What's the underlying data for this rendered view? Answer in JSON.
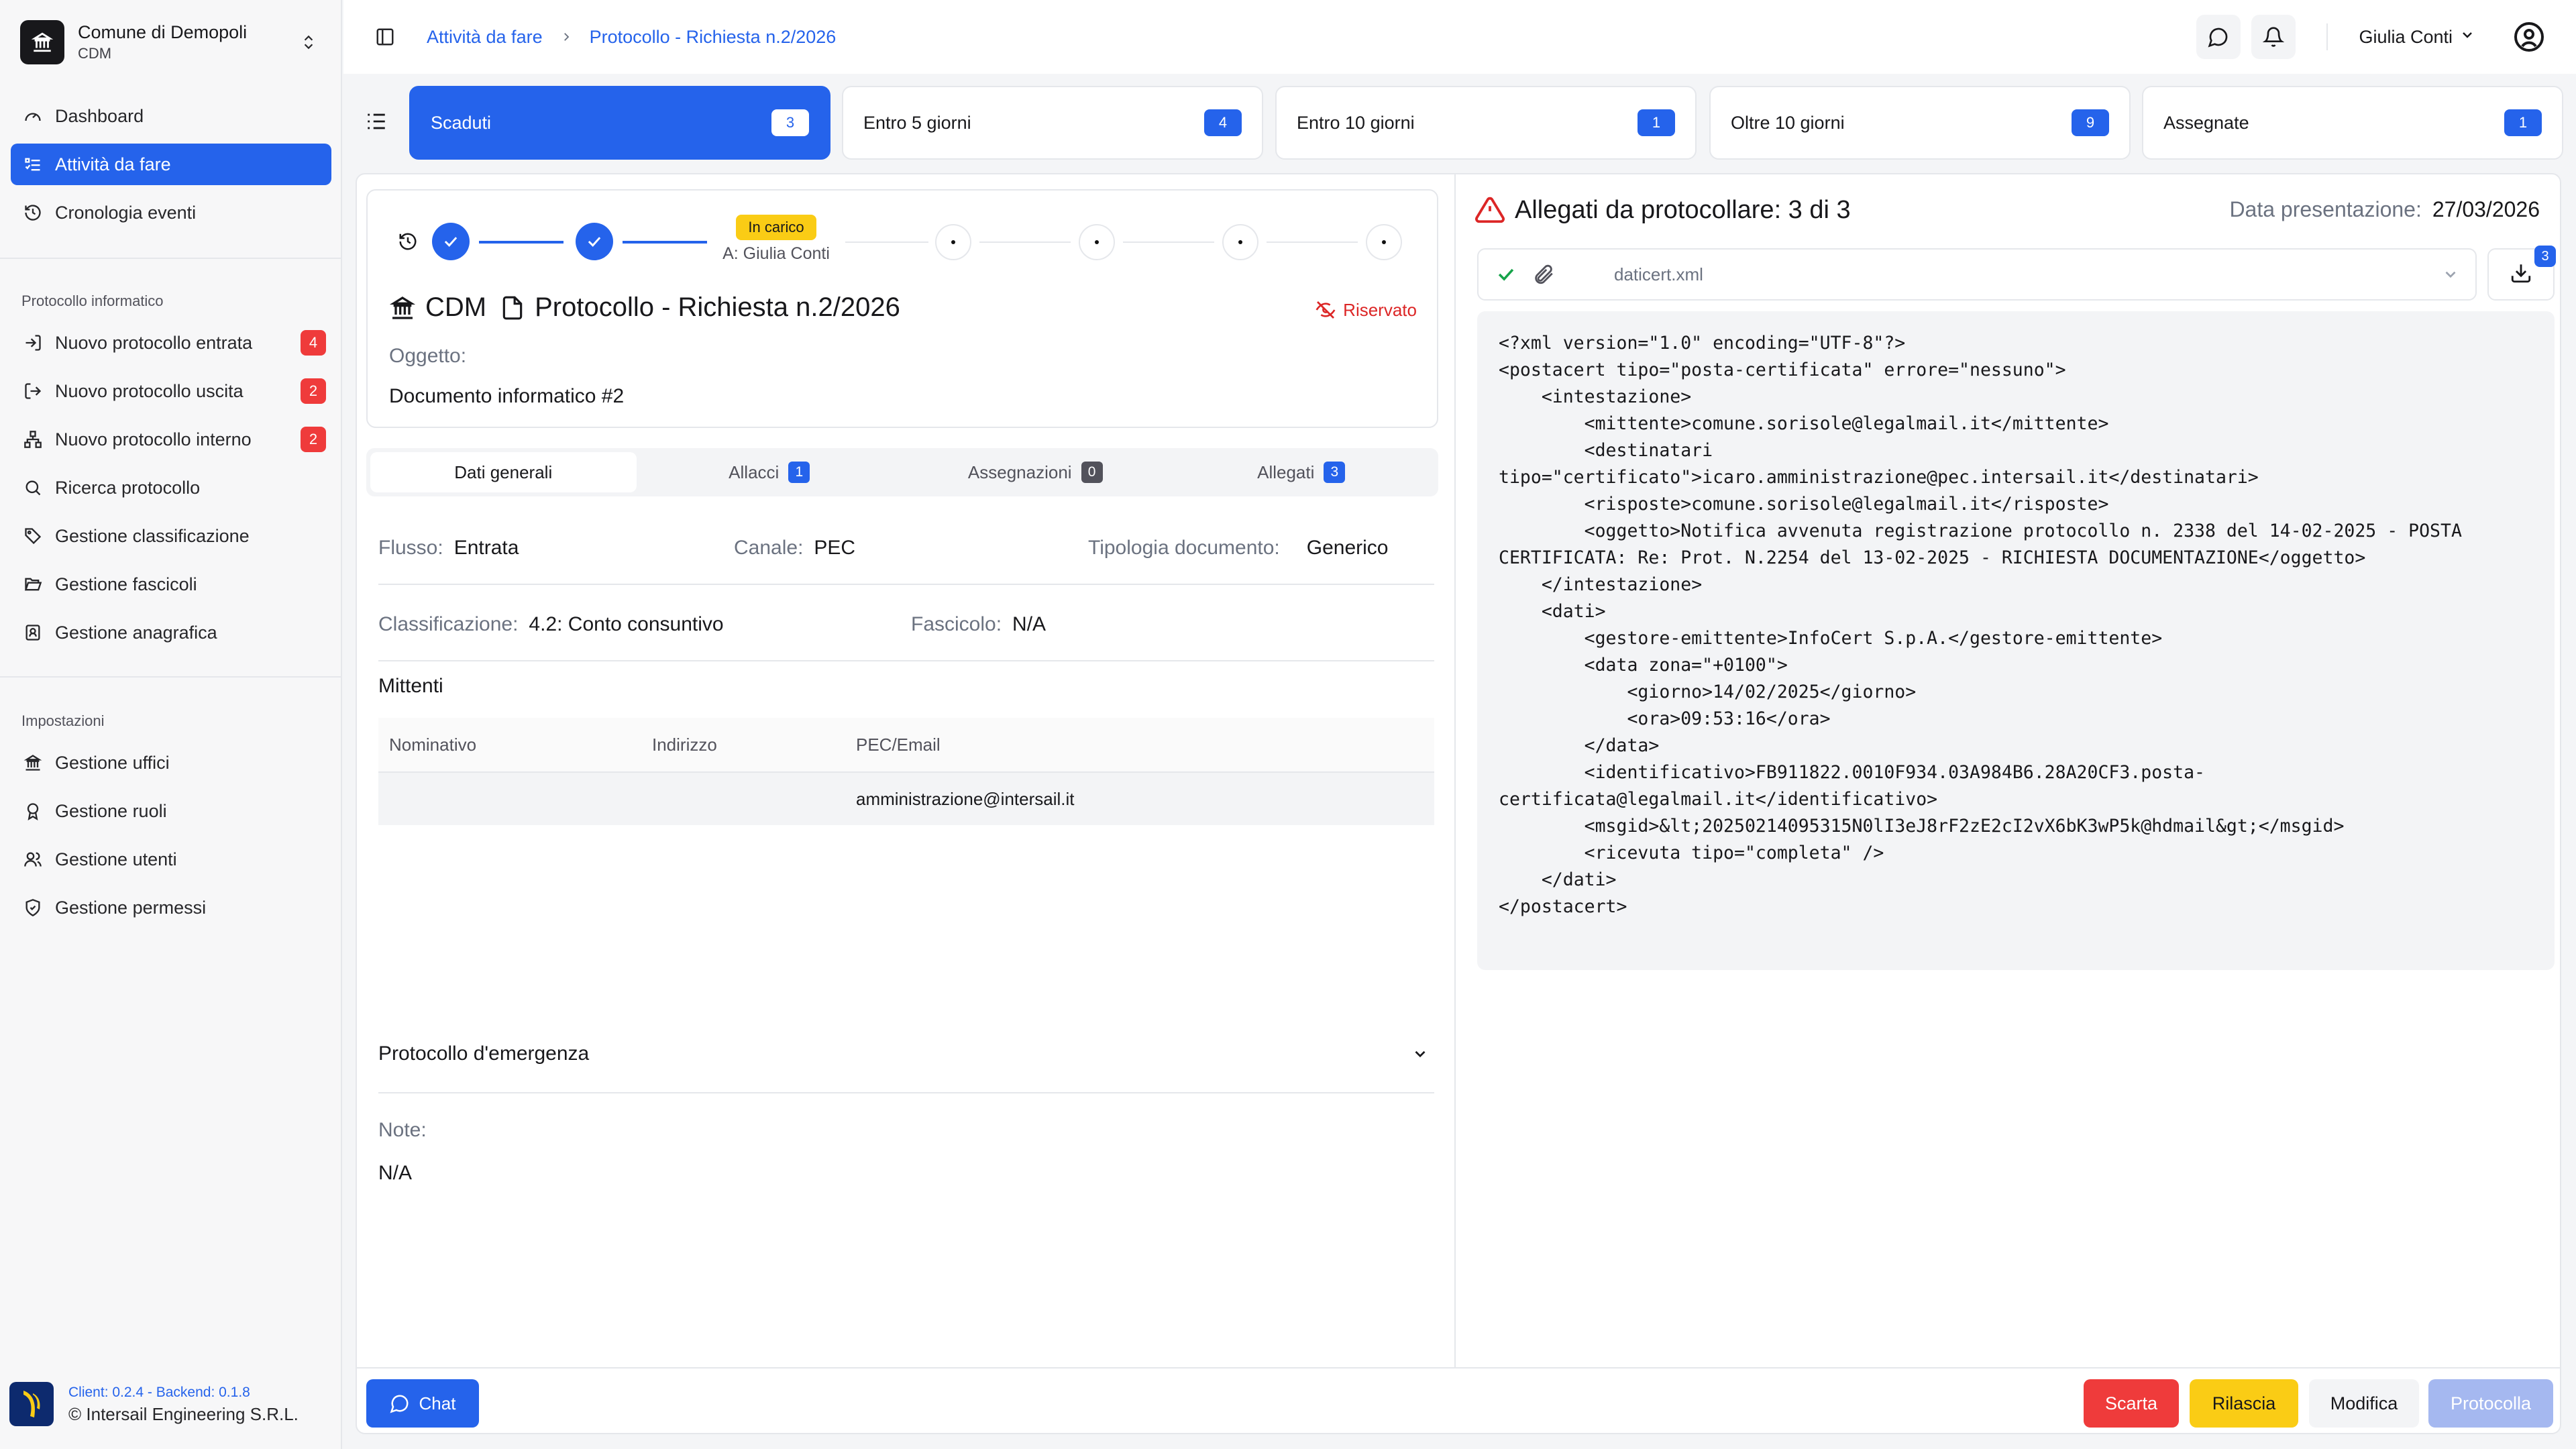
{
  "sidebar": {
    "org_name": "Comune di Demopoli",
    "org_code": "CDM",
    "nav": [
      {
        "label": "Dashboard",
        "icon": "dashboard-icon"
      },
      {
        "label": "Attività da fare",
        "icon": "tasks-icon",
        "active": true
      },
      {
        "label": "Cronologia eventi",
        "icon": "history-icon"
      }
    ],
    "section_protocollo": "Protocollo informatico",
    "protocollo": [
      {
        "label": "Nuovo protocollo entrata",
        "badge": "4"
      },
      {
        "label": "Nuovo protocollo uscita",
        "badge": "2"
      },
      {
        "label": "Nuovo protocollo interno",
        "badge": "2"
      },
      {
        "label": "Ricerca protocollo"
      },
      {
        "label": "Gestione classificazione"
      },
      {
        "label": "Gestione fascicoli"
      },
      {
        "label": "Gestione anagrafica"
      }
    ],
    "section_impostazioni": "Impostazioni",
    "impostazioni": [
      {
        "label": "Gestione uffici"
      },
      {
        "label": "Gestione ruoli"
      },
      {
        "label": "Gestione utenti"
      },
      {
        "label": "Gestione permessi"
      }
    ],
    "version": "Client: 0.2.4 - Backend: 0.1.8",
    "copyright": "© Intersail Engineering S.R.L."
  },
  "topbar": {
    "breadcrumb": [
      "Attività da fare",
      "Protocollo - Richiesta n.2/2026"
    ],
    "user_name": "Giulia Conti"
  },
  "filter_tabs": [
    {
      "label": "Scaduti",
      "count": "3",
      "active": true
    },
    {
      "label": "Entro 5 giorni",
      "count": "4"
    },
    {
      "label": "Entro 10 giorni",
      "count": "1"
    },
    {
      "label": "Oltre 10 giorni",
      "count": "9"
    },
    {
      "label": "Assegnate",
      "count": "1"
    }
  ],
  "detail": {
    "status_pill": "In carico",
    "assigned_to": "A: Giulia Conti",
    "org_code": "CDM",
    "title": "Protocollo - Richiesta n.2/2026",
    "reserved": "Riservato",
    "oggetto_label": "Oggetto:",
    "oggetto": "Documento informatico #2",
    "tabs": [
      {
        "label": "Dati generali",
        "active": true
      },
      {
        "label": "Allacci",
        "badge": "1"
      },
      {
        "label": "Assegnazioni",
        "badge": "0"
      },
      {
        "label": "Allegati",
        "badge": "3"
      }
    ],
    "flusso_label": "Flusso:",
    "flusso": "Entrata",
    "canale_label": "Canale:",
    "canale": "PEC",
    "tipologia_label": "Tipologia documento:",
    "tipologia": "Generico",
    "classificazione_label": "Classificazione:",
    "classificazione": "4.2: Conto consuntivo",
    "fascicolo_label": "Fascicolo:",
    "fascicolo": "N/A",
    "mittenti_title": "Mittenti",
    "mittenti_headers": [
      "Nominativo",
      "Indirizzo",
      "PEC/Email"
    ],
    "mittenti_rows": [
      [
        "",
        "",
        "amministrazione@intersail.it"
      ]
    ],
    "emergenza": "Protocollo d'emergenza",
    "note_label": "Note:",
    "note": "N/A"
  },
  "attachments": {
    "title": "Allegati da protocollare: 3 di 3",
    "date_label": "Data presentazione:",
    "date": "27/03/2026",
    "file_name": "daticert.xml",
    "download_badge": "3",
    "xml": "<?xml version=\"1.0\" encoding=\"UTF-8\"?>\n<postacert tipo=\"posta-certificata\" errore=\"nessuno\">\n    <intestazione>\n        <mittente>comune.sorisole@legalmail.it</mittente>\n        <destinatari\ntipo=\"certificato\">icaro.amministrazione@pec.intersail.it</destinatari>\n        <risposte>comune.sorisole@legalmail.it</risposte>\n        <oggetto>Notifica avvenuta registrazione protocollo n. 2338 del 14-02-2025 - POSTA CERTIFICATA: Re: Prot. N.2254 del 13-02-2025 - RICHIESTA DOCUMENTAZIONE</oggetto>\n    </intestazione>\n    <dati>\n        <gestore-emittente>InfoCert S.p.A.</gestore-emittente>\n        <data zona=\"+0100\">\n            <giorno>14/02/2025</giorno>\n            <ora>09:53:16</ora>\n        </data>\n        <identificativo>FB911822.0010F934.03A984B6.28A20CF3.posta-certificata@legalmail.it</identificativo>\n        <msgid>&lt;20250214095315N0lI3eJ8rF2zE2cI2vX6bK3wP5k@hdmail&gt;</msgid>\n        <ricevuta tipo=\"completa\" />\n    </dati>\n</postacert>"
  },
  "actions": {
    "chat": "Chat",
    "scarta": "Scarta",
    "rilascia": "Rilascia",
    "modifica": "Modifica",
    "protocolla": "Protocolla"
  },
  "colors": {
    "accent": "#2563eb",
    "danger": "#ef3b3b",
    "warning": "#facc15"
  }
}
